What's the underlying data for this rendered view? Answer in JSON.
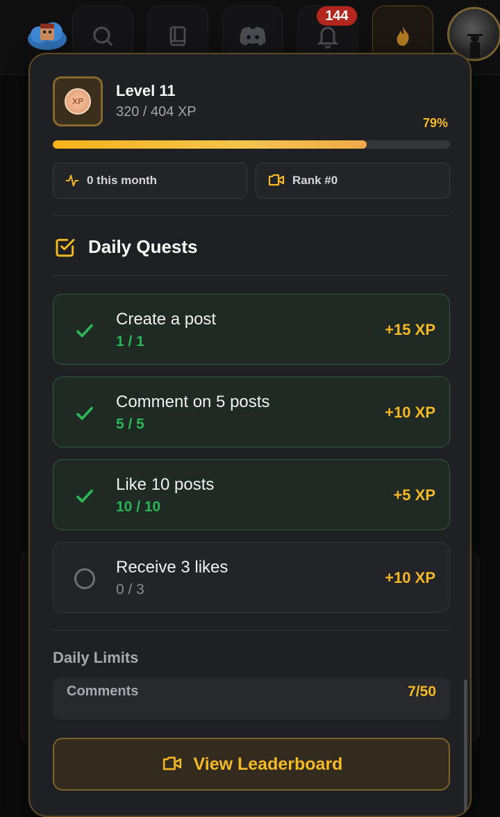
{
  "nav": {
    "notification_count": "144",
    "items": [
      "search-icon",
      "book-icon",
      "discord-icon",
      "bell-icon",
      "fire-icon"
    ]
  },
  "level": {
    "title": "Level 11",
    "xp_text": "320 / 404 XP",
    "percent_text": "79%",
    "progress": 0.79
  },
  "stats": {
    "monthly": "0 this month",
    "rank": "Rank #0"
  },
  "daily_quests": {
    "title": "Daily Quests",
    "items": [
      {
        "title": "Create a post",
        "progress": "1 / 1",
        "xp": "+15 XP",
        "done": true
      },
      {
        "title": "Comment on 5 posts",
        "progress": "5 / 5",
        "xp": "+10 XP",
        "done": true
      },
      {
        "title": "Like 10 posts",
        "progress": "10 / 10",
        "xp": "+5 XP",
        "done": true
      },
      {
        "title": "Receive 3 likes",
        "progress": "0 / 3",
        "xp": "+10 XP",
        "done": false
      }
    ]
  },
  "daily_limits": {
    "title": "Daily Limits",
    "rows": [
      {
        "label": "Comments",
        "value": "7/50"
      }
    ]
  },
  "leaderboard_button": "View Leaderboard",
  "colors": {
    "accent": "#f5b923",
    "success": "#2bb656",
    "panel": "#1f2023"
  }
}
